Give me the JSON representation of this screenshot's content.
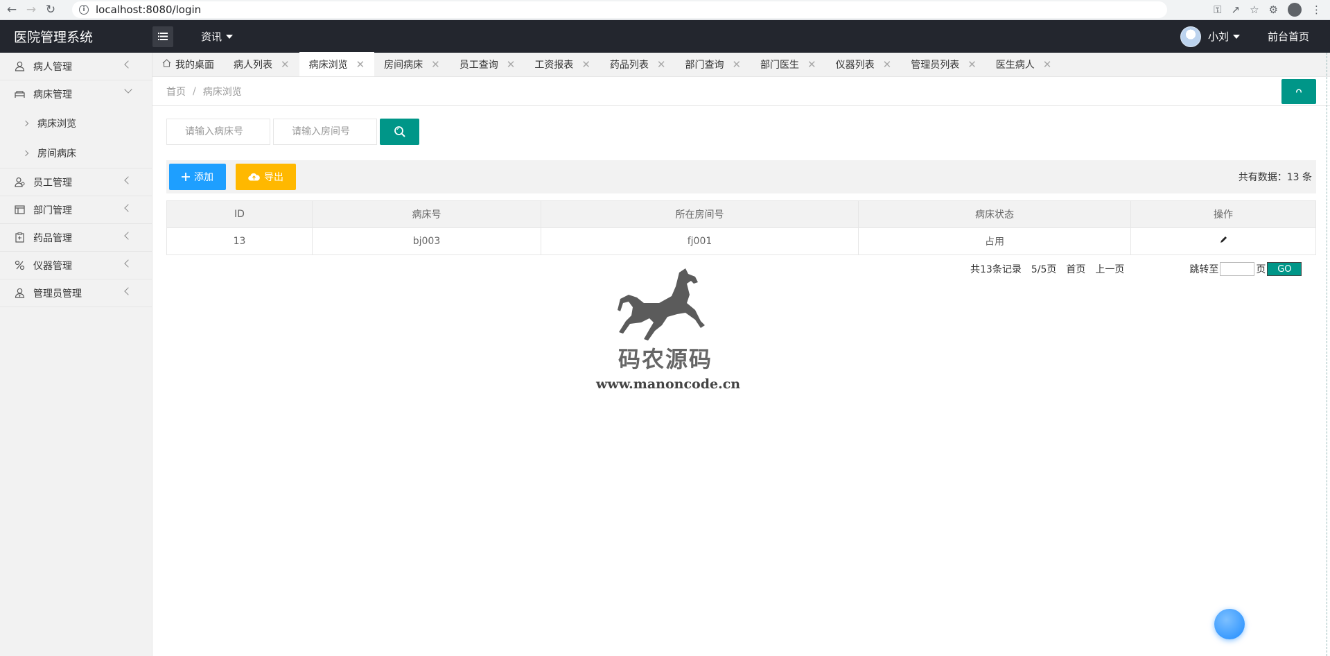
{
  "browser": {
    "url": "localhost:8080/login"
  },
  "header": {
    "logo": "医院管理系统",
    "news_label": "资讯",
    "user_name": "小刘",
    "front_home": "前台首页"
  },
  "sidebar": {
    "items": [
      {
        "label": "病人管理",
        "icon": "user-icon"
      },
      {
        "label": "病床管理",
        "icon": "bed-icon",
        "expanded": true,
        "children": [
          {
            "label": "病床浏览"
          },
          {
            "label": "房间病床"
          }
        ]
      },
      {
        "label": "员工管理",
        "icon": "staff-icon"
      },
      {
        "label": "部门管理",
        "icon": "department-icon"
      },
      {
        "label": "药品管理",
        "icon": "medicine-icon"
      },
      {
        "label": "仪器管理",
        "icon": "instrument-icon"
      },
      {
        "label": "管理员管理",
        "icon": "admin-icon"
      }
    ]
  },
  "tabs": [
    {
      "label": "我的桌面",
      "home": true
    },
    {
      "label": "病人列表"
    },
    {
      "label": "病床浏览",
      "active": true
    },
    {
      "label": "房间病床"
    },
    {
      "label": "员工查询"
    },
    {
      "label": "工资报表"
    },
    {
      "label": "药品列表"
    },
    {
      "label": "部门查询"
    },
    {
      "label": "部门医生"
    },
    {
      "label": "仪器列表"
    },
    {
      "label": "管理员列表"
    },
    {
      "label": "医生病人"
    }
  ],
  "breadcrumb": {
    "home": "首页",
    "current": "病床浏览"
  },
  "search": {
    "bed_placeholder": "请输入病床号",
    "room_placeholder": "请输入房间号"
  },
  "toolbar": {
    "add_label": "添加",
    "export_label": "导出",
    "total_text": "共有数据：13 条"
  },
  "table": {
    "headers": [
      "ID",
      "病床号",
      "所在房间号",
      "病床状态",
      "操作"
    ],
    "rows": [
      [
        "13",
        "bj003",
        "fj001",
        "占用"
      ]
    ]
  },
  "pager": {
    "records": "共13条记录",
    "page": "5/5页",
    "first": "首页",
    "prev": "上一页",
    "jump_label": "跳转至",
    "page_unit": "页",
    "go": "GO"
  },
  "watermark": {
    "title": "码农源码",
    "url": "www.manoncode.cn"
  },
  "colors": {
    "header_bg": "#23262e",
    "accent": "#009688",
    "add": "#1e9fff",
    "export": "#ffb800"
  }
}
